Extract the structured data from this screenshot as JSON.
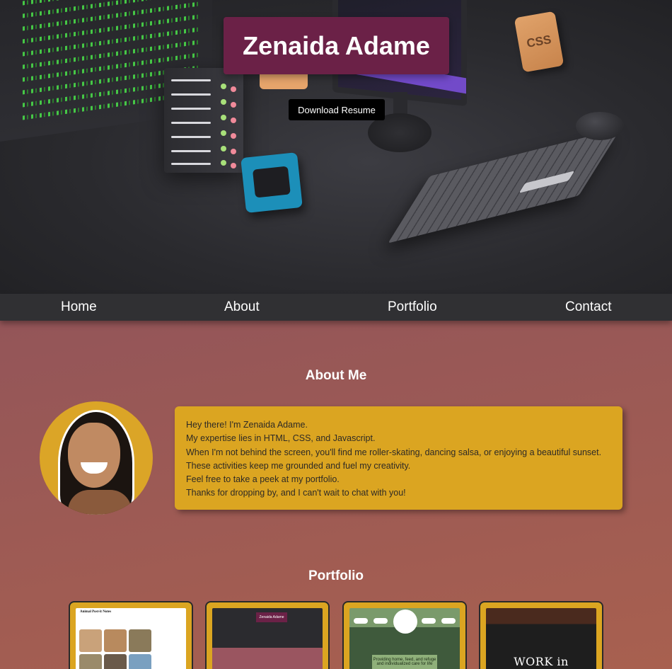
{
  "hero": {
    "name": "Zenaida Adame",
    "resume_button": "Download Resume",
    "css_block_text": "CSS"
  },
  "nav": {
    "items": [
      {
        "label": "Home"
      },
      {
        "label": "About"
      },
      {
        "label": "Portfolio"
      },
      {
        "label": "Contact"
      }
    ]
  },
  "about": {
    "title": "About Me",
    "lines": [
      "Hey there! I'm Zenaida Adame.",
      "My expertise lies in HTML, CSS, and Javascript.",
      "When I'm not behind the screen, you'll find me roller-skating, dancing salsa, or enjoying a beautiful sunset.",
      "These activities keep me grounded and fuel my creativity.",
      "Feel free to take a peek at my portfolio.",
      "Thanks for dropping by, and I can't wait to chat with you!"
    ]
  },
  "portfolio": {
    "title": "Portfolio",
    "items": [
      {
        "preview_text": "Animal Post-it Notes"
      },
      {
        "preview_text": "Zenaida Adame"
      },
      {
        "preview_text": "Providing home, feed, and refuge and individualized care for life"
      },
      {
        "preview_text": "WORK in PROGRESS"
      }
    ]
  },
  "colors": {
    "title_box": "#6b2147",
    "card": "#dba521",
    "nav": "#303033"
  }
}
